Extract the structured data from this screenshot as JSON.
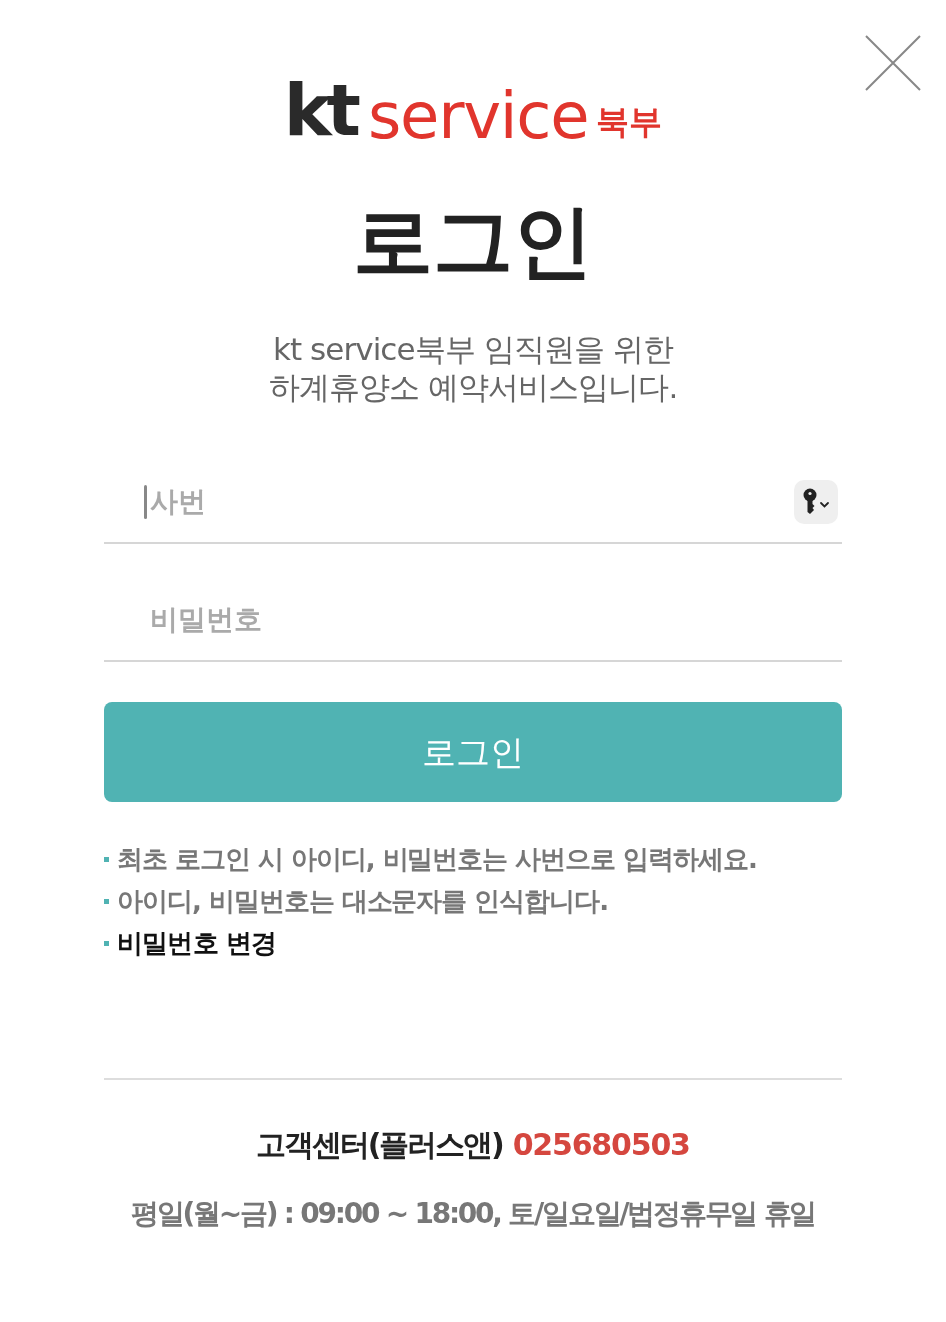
{
  "logo": {
    "brand": "kt",
    "name": "service",
    "region": "북부"
  },
  "title": "로그인",
  "subtitle": [
    "kt service북부 임직원을 위한",
    "하계휴양소 예약서비스입니다."
  ],
  "fields": [
    {
      "placeholder": "사번",
      "focused": true
    },
    {
      "placeholder": "비밀번호",
      "focused": false
    }
  ],
  "login_button": {
    "label": "로그인"
  },
  "notes": [
    {
      "kind": "info",
      "text": "최초 로그인 시 아이디, 비밀번호는 사번으로 입력하세요."
    },
    {
      "kind": "info",
      "text": "아이디, 비밀번호는 대소문자를 인식합니다."
    },
    {
      "kind": "link",
      "text": "비밀번호 변경"
    }
  ],
  "footer": {
    "center_label": "고객센터(플러스앤)",
    "phone": "025680503",
    "hours": "평일(월~금) : 09:00 ~ 18:00, 토/일요일/법정휴무일 휴일"
  }
}
